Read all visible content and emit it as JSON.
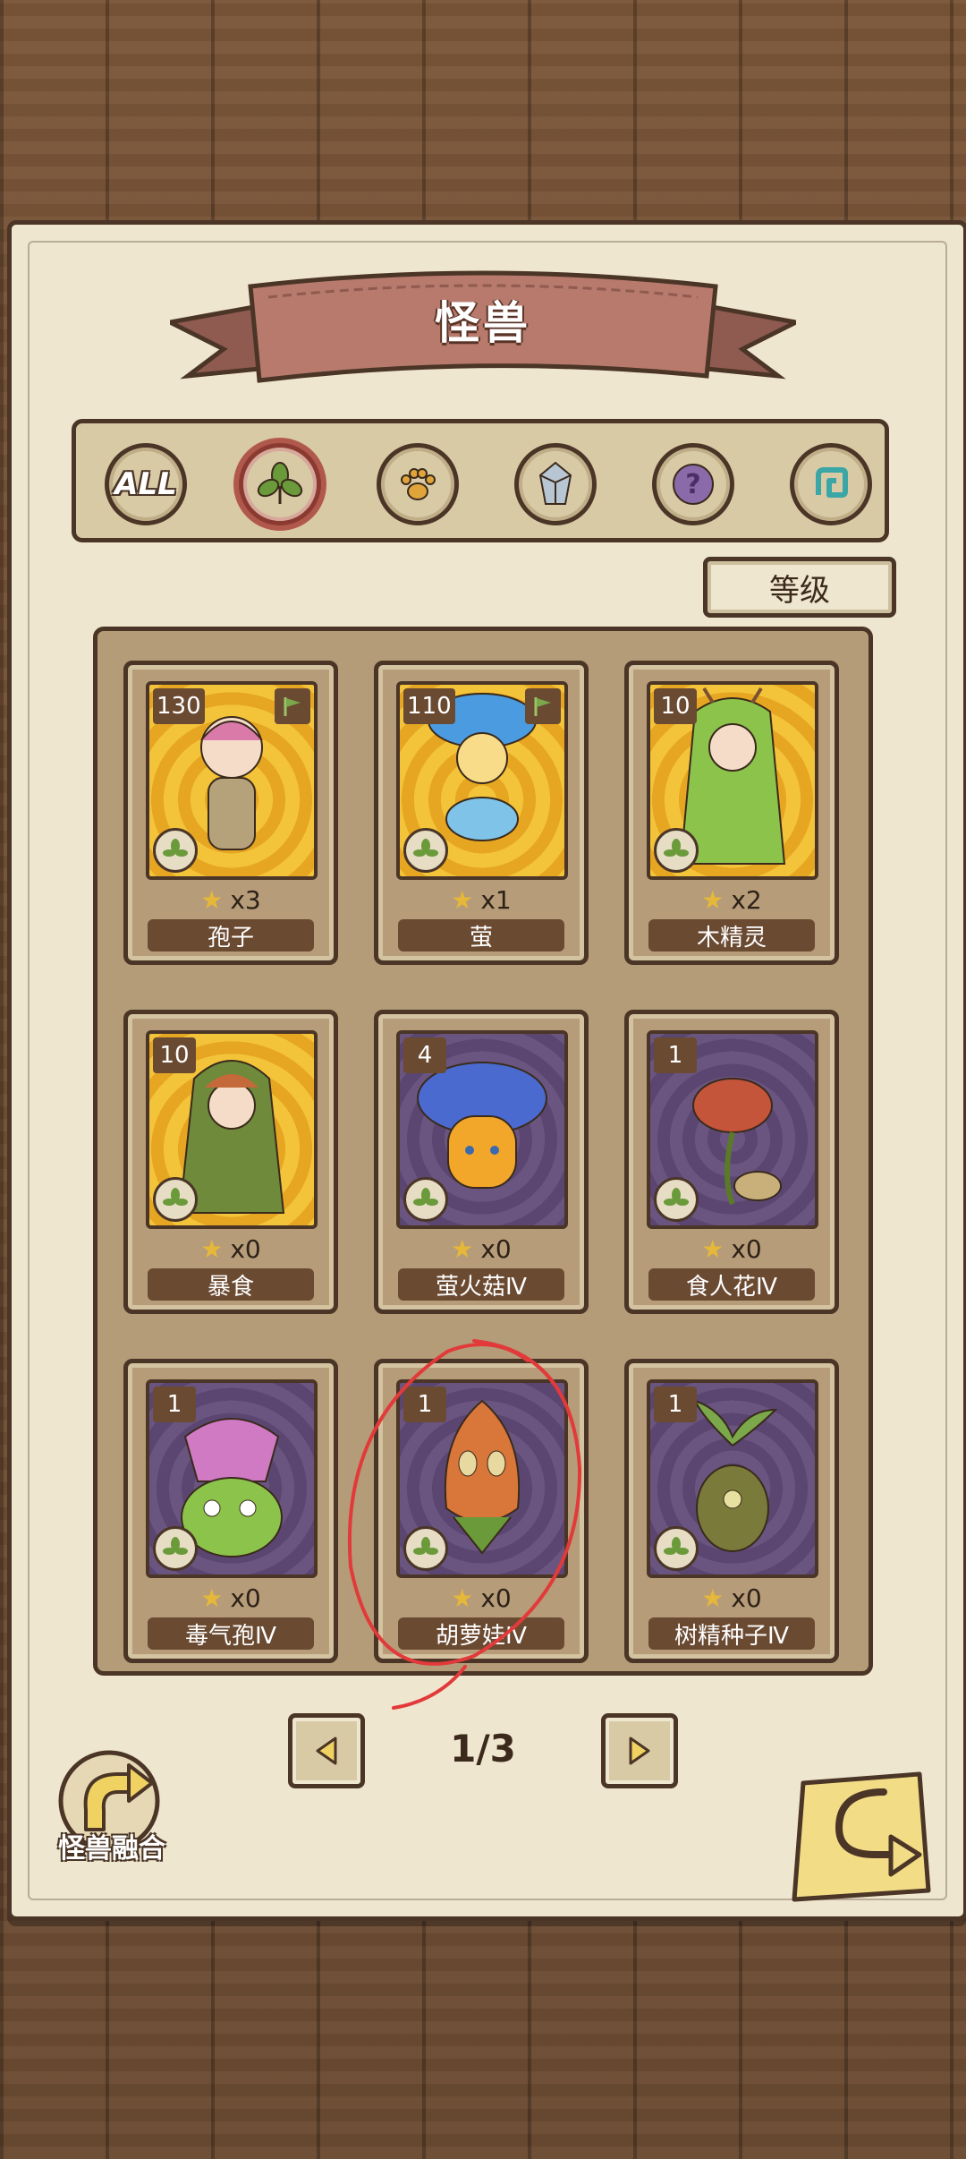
{
  "header": {
    "title": "怪兽"
  },
  "filters": [
    {
      "id": "all",
      "label": "ALL",
      "icon": "all-icon"
    },
    {
      "id": "plant",
      "label": "",
      "icon": "leaf-icon",
      "active": true
    },
    {
      "id": "beast",
      "label": "",
      "icon": "paw-icon"
    },
    {
      "id": "mineral",
      "label": "",
      "icon": "crystal-icon"
    },
    {
      "id": "unknown",
      "label": "",
      "icon": "question-icon"
    },
    {
      "id": "other",
      "label": "",
      "icon": "swirl-icon"
    }
  ],
  "sort": {
    "label": "等级"
  },
  "cards": [
    {
      "level": "130",
      "stars": "x3",
      "name": "孢子",
      "bg": "yellow",
      "flag": true
    },
    {
      "level": "110",
      "stars": "x1",
      "name": "萤",
      "bg": "yellow",
      "flag": true
    },
    {
      "level": "10",
      "stars": "x2",
      "name": "木精灵",
      "bg": "yellow",
      "flag": false
    },
    {
      "level": "10",
      "stars": "x0",
      "name": "暴食",
      "bg": "yellow",
      "flag": false
    },
    {
      "level": "4",
      "stars": "x0",
      "name": "萤火菇Ⅳ",
      "bg": "purple",
      "flag": false
    },
    {
      "level": "1",
      "stars": "x0",
      "name": "食人花Ⅳ",
      "bg": "purple",
      "flag": false
    },
    {
      "level": "1",
      "stars": "x0",
      "name": "毒气孢Ⅳ",
      "bg": "purple",
      "flag": false
    },
    {
      "level": "1",
      "stars": "x0",
      "name": "胡萝娃Ⅳ",
      "bg": "purple",
      "flag": false
    },
    {
      "level": "1",
      "stars": "x0",
      "name": "树精种子Ⅳ",
      "bg": "purple",
      "flag": false
    }
  ],
  "pagination": {
    "current": "1/3"
  },
  "fusion": {
    "label": "怪兽融合"
  },
  "colors": {
    "accent_active": "#b1584c",
    "panel": "#efe6cf",
    "outline": "#4a3526"
  }
}
